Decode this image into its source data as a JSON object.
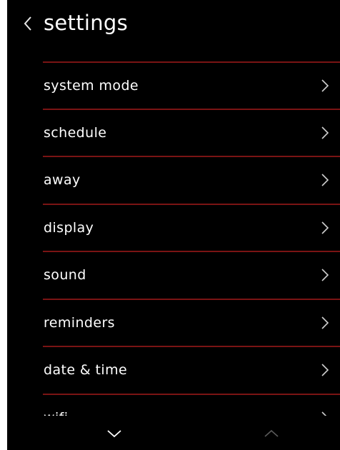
{
  "header": {
    "title": "settings",
    "back_icon": "chevron-left-icon"
  },
  "menu": {
    "items": [
      {
        "label": "system mode",
        "icon": "chevron-right-icon"
      },
      {
        "label": "schedule",
        "icon": "chevron-right-icon"
      },
      {
        "label": "away",
        "icon": "chevron-right-icon"
      },
      {
        "label": "display",
        "icon": "chevron-right-icon"
      },
      {
        "label": "sound",
        "icon": "chevron-right-icon"
      },
      {
        "label": "reminders",
        "icon": "chevron-right-icon"
      },
      {
        "label": "date & time",
        "icon": "chevron-right-icon"
      },
      {
        "label": "wifi",
        "icon": "chevron-right-icon"
      }
    ]
  },
  "footer": {
    "down_icon": "chevron-down-icon",
    "up_icon": "chevron-up-icon",
    "up_enabled": false
  },
  "colors": {
    "background": "#000000",
    "text": "#ffffff",
    "divider": "#7a1414",
    "chevron": "#cfcfcf",
    "disabled": "#5a5a5a"
  }
}
